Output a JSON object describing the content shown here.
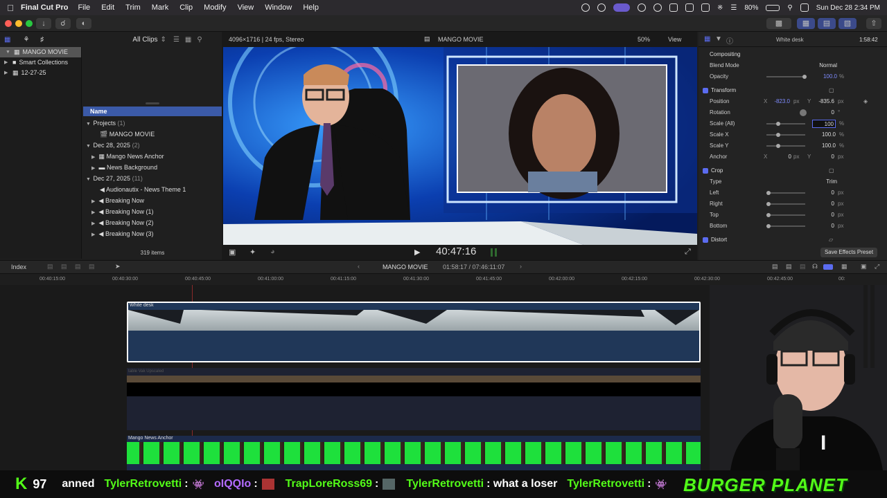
{
  "menubar": {
    "app_name": "Final Cut Pro",
    "items": [
      "File",
      "Edit",
      "Trim",
      "Mark",
      "Clip",
      "Modify",
      "View",
      "Window",
      "Help"
    ],
    "battery": "80%",
    "clock": "Sun Dec 28  2:34 PM"
  },
  "browser": {
    "filter": "All Clips",
    "library": "MANGO MOVIE",
    "sidebar": [
      "MANGO MOVIE",
      "Smart Collections",
      "12-27-25"
    ],
    "column_header": "Name",
    "groups": [
      {
        "name": "Projects",
        "count": "(1)",
        "items": [
          "MANGO MOVIE"
        ]
      },
      {
        "name": "Dec 28, 2025",
        "count": "(2)",
        "items": [
          "Mango News Anchor",
          "News Background"
        ]
      },
      {
        "name": "Dec 27, 2025",
        "count": "(11)",
        "items": [
          "Audionautix - News Theme 1",
          "Breaking Now",
          "Breaking Now (1)",
          "Breaking Now (2)",
          "Breaking Now (3)"
        ]
      }
    ],
    "item_count": "319 items"
  },
  "viewer": {
    "format": "4096×1716 | 24 fps, Stereo",
    "title": "MANGO MOVIE",
    "zoom": "50%",
    "view_label": "View",
    "timecode": "40:47:16"
  },
  "inspector": {
    "clip_name": "White desk",
    "duration": "1:58:42",
    "compositing": "Compositing",
    "blend_mode_label": "Blend Mode",
    "blend_mode": "Normal",
    "opacity_label": "Opacity",
    "opacity": "100.0",
    "transform": "Transform",
    "position_label": "Position",
    "pos_x": "-823.0",
    "pos_y": "-835.6",
    "rotation_label": "Rotation",
    "rotation": "0",
    "scale_all_label": "Scale (All)",
    "scale_all": "100",
    "scale_x_label": "Scale X",
    "scale_x": "100.0",
    "scale_y_label": "Scale Y",
    "scale_y": "100.0",
    "anchor_label": "Anchor",
    "anchor_x": "0",
    "anchor_y": "0",
    "crop": "Crop",
    "type_label": "Type",
    "type": "Trim",
    "left_label": "Left",
    "right_label": "Right",
    "top_label": "Top",
    "bottom_label": "Bottom",
    "crop_val": "0",
    "distort": "Distort",
    "save_preset": "Save Effects Preset",
    "px": "px",
    "pct": "%",
    "deg": "°",
    "x": "X",
    "y": "Y"
  },
  "timeline": {
    "index": "Index",
    "project": "MANGO MOVIE",
    "position": "01:58:17 / 07:46:11:07",
    "ruler": [
      "00:40:15:00",
      "00:40:30:00",
      "00:40:45:00",
      "00:41:00:00",
      "00:41:15:00",
      "00:41:30:00",
      "00:41:45:00",
      "00:42:00:00",
      "00:42:15:00",
      "00:42:30:00",
      "00:42:45:00",
      "00:"
    ],
    "clip1": "White desk",
    "clip2": "table Vak Upscaled",
    "clip3": "Mango News Anchor"
  },
  "chat": {
    "kick_count": "97",
    "messages": [
      {
        "user": "anned",
        "text": ""
      },
      {
        "user": "TylerRetrovetti",
        "text": ":"
      },
      {
        "user": "oIQQIo",
        "text": ":"
      },
      {
        "user": "TrapLoreRoss69",
        "text": ":"
      },
      {
        "user": "TylerRetrovetti",
        "text": ": what a loser"
      },
      {
        "user": "TylerRetrovetti",
        "text": ":"
      }
    ],
    "banner": "BURGER PLANET"
  },
  "colors": {
    "accent": "#5b6cf0",
    "chat_green": "#53fc18",
    "chat_purple": "#b36bff",
    "selection": "#3b5aa8"
  }
}
